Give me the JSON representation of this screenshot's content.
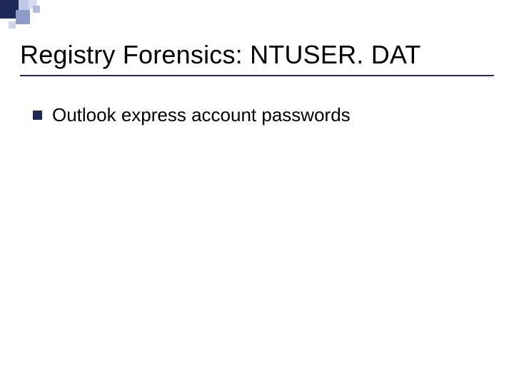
{
  "slide": {
    "title": "Registry Forensics: NTUSER. DAT",
    "bullets": [
      {
        "text": "Outlook express account passwords"
      }
    ]
  }
}
